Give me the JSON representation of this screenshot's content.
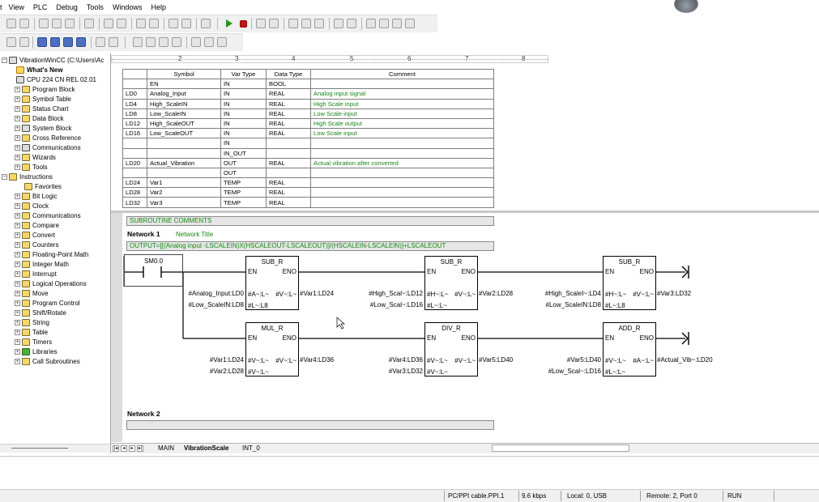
{
  "menu": [
    "t",
    "View",
    "PLC",
    "Debug",
    "Tools",
    "Windows",
    "Help"
  ],
  "tree": {
    "root": "VibrationWinCC (C:\\Users\\Ac",
    "items": [
      "What's New",
      "CPU 224 CN REL 02.01",
      "Program Block",
      "Symbol Table",
      "Status Chart",
      "Data Block",
      "System Block",
      "Cross Reference",
      "Communications",
      "Wizards",
      "Tools",
      "Instructions",
      "Favorites",
      "Bit Logic",
      "Clock",
      "Communications",
      "Compare",
      "Convert",
      "Counters",
      "Floating-Point Math",
      "Integer Math",
      "Interrupt",
      "Logical Operations",
      "Move",
      "Program Control",
      "Shift/Rotate",
      "String",
      "Table",
      "Timers",
      "Libraries",
      "Call Subroutines"
    ]
  },
  "ruler": [
    "2",
    "3",
    "4",
    "5",
    "6",
    "7",
    "8"
  ],
  "vartable": {
    "headers": [
      "",
      "Symbol",
      "Var Type",
      "Data Type",
      "Comment"
    ],
    "rows": [
      [
        "",
        "EN",
        "IN",
        "BOOL",
        ""
      ],
      [
        "LD0",
        "Analog_Input",
        "IN",
        "REAL",
        "Analog input signal"
      ],
      [
        "LD4",
        "High_ScaleIN",
        "IN",
        "REAL",
        "High Scale input"
      ],
      [
        "LD8",
        "Low_ScaleIN",
        "IN",
        "REAL",
        "Low Scale input"
      ],
      [
        "LD12",
        "High_ScaleOUT",
        "IN",
        "REAL",
        "High Scale output"
      ],
      [
        "LD16",
        "Low_ScaleOUT",
        "IN",
        "REAL",
        "Low Scale input"
      ],
      [
        "",
        "",
        "IN",
        "",
        ""
      ],
      [
        "",
        "",
        "IN_OUT",
        "",
        ""
      ],
      [
        "LD20",
        "Actual_Vibration",
        "OUT",
        "REAL",
        "Actual vibration after converted"
      ],
      [
        "",
        "",
        "OUT",
        "",
        ""
      ],
      [
        "LD24",
        "Var1",
        "TEMP",
        "REAL",
        ""
      ],
      [
        "LD28",
        "Var2",
        "TEMP",
        "REAL",
        ""
      ],
      [
        "LD32",
        "Var3",
        "TEMP",
        "REAL",
        ""
      ]
    ]
  },
  "editor": {
    "subroutine_comments": "SUBROUTINE COMMENTS",
    "network1_label": "Network 1",
    "network1_title": "Network Title",
    "network1_comment": "OUTPUT=[[(Analog input -LSCALEIN)X(HSCALEOUT-LSCALEOUT)]/(HSCALEIN-LSCALEIN)]+LSCALEOUT",
    "contact": "SM0.0",
    "network2_label": "Network 2",
    "blocks": [
      {
        "title": "SUB_R",
        "en": "EN",
        "eno": "ENO",
        "in1_pin": "#A~:L~",
        "in2_pin": "#L~:L8",
        "out_pin": "#V~:L~",
        "in1": "#Analog_Input:LD0",
        "in2": "#Low_ScaleIN:LD8",
        "out": "#Var1:LD24"
      },
      {
        "title": "SUB_R",
        "en": "EN",
        "eno": "ENO",
        "in1_pin": "#H~:L~",
        "in2_pin": "#L~:L~",
        "out_pin": "#V~:L~",
        "in1": "#High_Scal~:LD12",
        "in2": "#Low_Scal~:LD16",
        "out": "#Var2:LD28"
      },
      {
        "title": "SUB_R",
        "en": "EN",
        "eno": "ENO",
        "in1_pin": "#H~:L~",
        "in2_pin": "#L~:L8",
        "out_pin": "#V~:L~",
        "in1": "#High_ScaleI~:LD4",
        "in2": "#Low_ScaleIN:LD8",
        "out": "#Var3:LD32"
      },
      {
        "title": "MUL_R",
        "en": "EN",
        "eno": "ENO",
        "in1_pin": "#V~:L~",
        "in2_pin": "#V~:L~",
        "out_pin": "#V~:L~",
        "in1": "#Var1:LD24",
        "in2": "#Var2:LD28",
        "out": "#Var4:LD36"
      },
      {
        "title": "DIV_R",
        "en": "EN",
        "eno": "ENO",
        "in1_pin": "#V~:L~",
        "in2_pin": "#V~:L~",
        "out_pin": "#V~:L~",
        "in1": "#Var4:LD36",
        "in2": "#Var3:LD32",
        "out": "#Var5:LD40"
      },
      {
        "title": "ADD_R",
        "en": "EN",
        "eno": "ENO",
        "in1_pin": "#V~:L~",
        "in2_pin": "#L~:L~",
        "out_pin": "#A~:L~",
        "in1": "#Var5:LD40",
        "in2": "#Low_Scal~:LD16",
        "out": "#Actual_Vib~:LD20"
      }
    ]
  },
  "tabs": [
    "MAIN",
    "VibrationScale",
    "INT_0"
  ],
  "status": {
    "cable": "PC/PPI cable.PPI.1",
    "baud": "9.6 kbps",
    "local": "Local: 0, USB",
    "remote": "Remote: 2, Port 0",
    "mode": "RUN"
  }
}
